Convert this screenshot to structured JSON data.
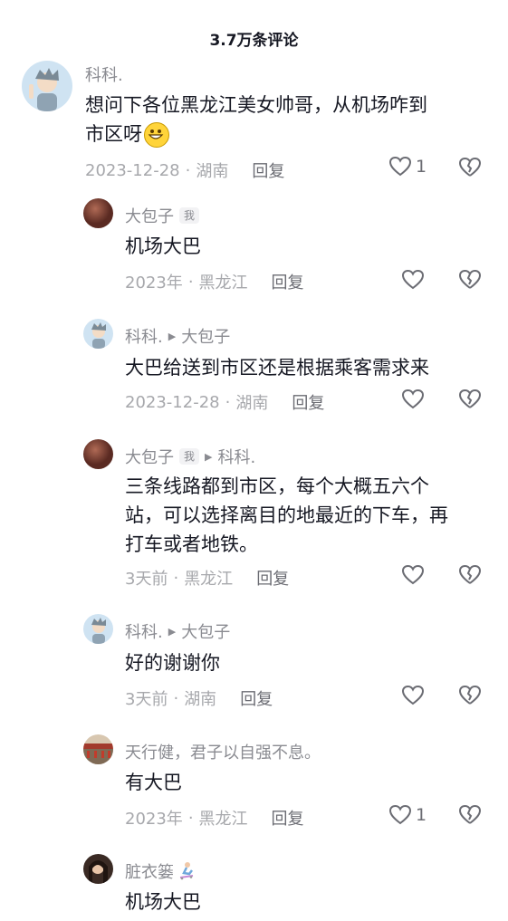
{
  "header": {
    "title": "3.7万条评论"
  },
  "comments": [
    {
      "author": "科科.",
      "content_line1": "想问下各位黑龙江美女帅哥，从机场咋到",
      "content_line2": "市区呀",
      "emoji": "grin-emoji",
      "date": "2023-12-28",
      "location": "湖南",
      "reply_label": "回复",
      "likes": "1"
    },
    {
      "author": "大包子",
      "badge": "我",
      "content": "机场大巴",
      "date": "2023年",
      "location": "黑龙江",
      "reply_label": "回复"
    },
    {
      "author": "科科.",
      "reply_to": "大包子",
      "content": "大巴给送到市区还是根据乘客需求来",
      "date": "2023-12-28",
      "location": "湖南",
      "reply_label": "回复"
    },
    {
      "author": "大包子",
      "badge": "我",
      "reply_to": "科科.",
      "content_line1": "三条线路都到市区，每个大概五六个",
      "content_line2": "站，可以选择离目的地最近的下车，再",
      "content_line3": "打车或者地铁。",
      "date": "3天前",
      "location": "黑龙江",
      "reply_label": "回复"
    },
    {
      "author": "科科.",
      "reply_to": "大包子",
      "content": "好的谢谢你",
      "date": "3天前",
      "location": "湖南",
      "reply_label": "回复"
    },
    {
      "author": "天行健，君子以自强不息。",
      "content": "有大巴",
      "date": "2023年",
      "location": "黑龙江",
      "reply_label": "回复",
      "likes": "1"
    },
    {
      "author": "脏衣篓",
      "content": "机场大巴"
    }
  ],
  "colors": {
    "text": "#161823",
    "muted": "#8a8b91",
    "meta": "#a7a8ac"
  }
}
